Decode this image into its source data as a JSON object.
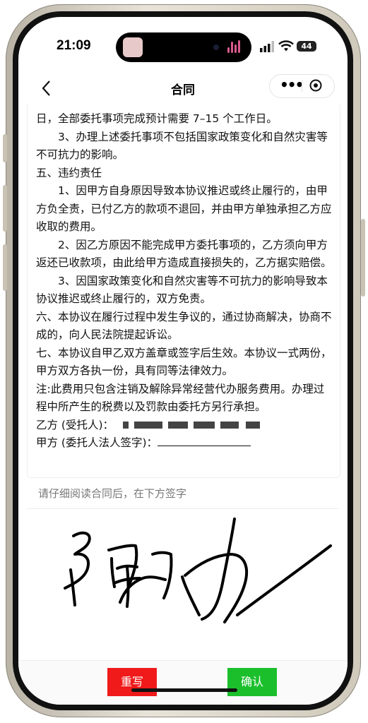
{
  "status_bar": {
    "time": "21:09",
    "battery": "44"
  },
  "nav": {
    "title": "合同",
    "menu_icon": "more-dots-icon",
    "close_icon": "record-icon"
  },
  "contract": {
    "paragraphs": [
      "日，全部委托事项完成预计需要 7–15 个工作日。",
      "3、办理上述委托事项不包括国家政策变化和自然灾害等不可抗力的影响。",
      "五、违约责任",
      "1、因甲方自身原因导致本协议推迟或终止履行的，由甲方负全责，已付乙方的款项不退回，并由甲方单独承担乙方应收取的费用。",
      "2、因乙方原因不能完成甲方委托事项的，乙方须向甲方返还已收款项，由此给甲方造成直接损失的，乙方据实赔偿。",
      "3、因国家政策变化和自然灾害等不可抗力的影响导致本协议推迟或终止履行的，双方免责。",
      "六、本协议在履行过程中发生争议的，通过协商解决，协商不成的，向人民法院提起诉讼。",
      "七、本协议自甲乙双方盖章或签字后生效。本协议一式两份，甲方双方各执一份，具有同等法律效力。",
      "注:此费用只包含注销及解除异常经营代办服务费用。办理过程中所产生的税费以及罚款由委托方另行承担。"
    ],
    "party_b_label": "乙方 (受托人)：",
    "party_a_label": "甲方 (委托人法人签字)："
  },
  "hint": "请仔细阅读合同后，在下方签字",
  "buttons": {
    "rewrite": "重写",
    "confirm": "确认"
  },
  "colors": {
    "rewrite": "#f01a1a",
    "confirm": "#1bbf2c"
  }
}
